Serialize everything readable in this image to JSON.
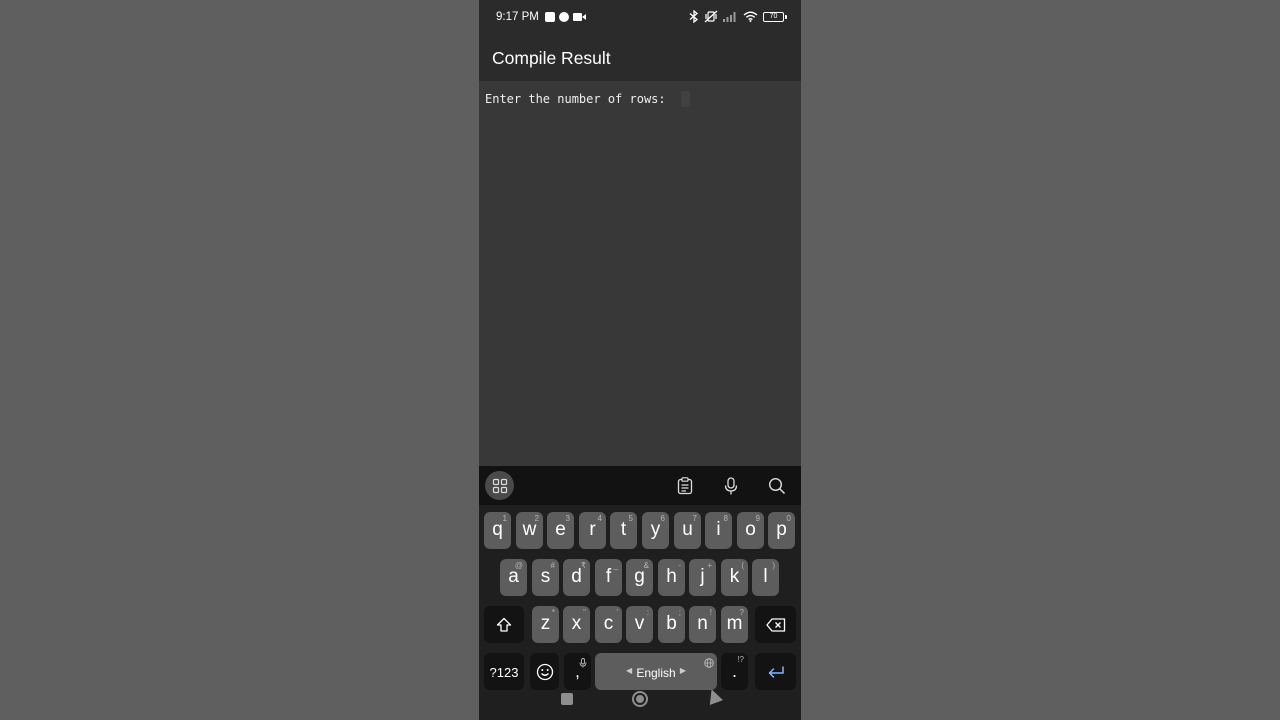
{
  "status_bar": {
    "time": "9:17 PM",
    "battery": "70",
    "left_icons": [
      "upload-box-icon",
      "circle-dot-icon",
      "video-camera-icon"
    ],
    "right_icons": [
      "bluetooth-icon",
      "vibrate-off-icon",
      "signal-bars-icon",
      "wifi-icon",
      "battery-icon"
    ]
  },
  "app_bar": {
    "title": "Compile Result"
  },
  "console": {
    "output": "Enter the number of rows: "
  },
  "keyboard": {
    "toolbar_icons": [
      "grid-menu-icon",
      "clipboard-icon",
      "microphone-icon",
      "search-icon"
    ],
    "row1": [
      {
        "key": "q",
        "hint": "1"
      },
      {
        "key": "w",
        "hint": "2"
      },
      {
        "key": "e",
        "hint": "3"
      },
      {
        "key": "r",
        "hint": "4"
      },
      {
        "key": "t",
        "hint": "5"
      },
      {
        "key": "y",
        "hint": "6"
      },
      {
        "key": "u",
        "hint": "7"
      },
      {
        "key": "i",
        "hint": "8"
      },
      {
        "key": "o",
        "hint": "9"
      },
      {
        "key": "p",
        "hint": "0"
      }
    ],
    "row2": [
      {
        "key": "a",
        "hint": "@"
      },
      {
        "key": "s",
        "hint": "#"
      },
      {
        "key": "d",
        "hint": "₹"
      },
      {
        "key": "f",
        "hint": "_"
      },
      {
        "key": "g",
        "hint": "&"
      },
      {
        "key": "h",
        "hint": "-"
      },
      {
        "key": "j",
        "hint": "+"
      },
      {
        "key": "k",
        "hint": "("
      },
      {
        "key": "l",
        "hint": ")"
      }
    ],
    "row3": [
      {
        "key": "z",
        "hint": "*"
      },
      {
        "key": "x",
        "hint": "\""
      },
      {
        "key": "c",
        "hint": "'"
      },
      {
        "key": "v",
        "hint": ":"
      },
      {
        "key": "b",
        "hint": ";"
      },
      {
        "key": "n",
        "hint": "!"
      },
      {
        "key": "m",
        "hint": "?"
      }
    ],
    "symbols_label": "?123",
    "comma": ",",
    "space_label": "English",
    "period": ".",
    "period_hint": "!?",
    "accent_color": "#8ab4f8"
  },
  "nav_bar": {
    "icons": [
      "recents-square-icon",
      "home-circle-icon",
      "back-triangle-icon"
    ]
  }
}
